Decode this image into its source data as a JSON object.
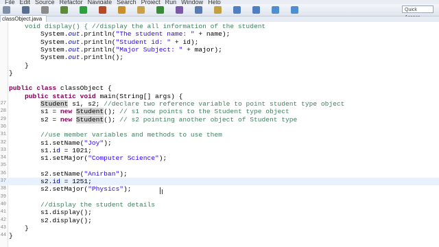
{
  "menu": [
    "File",
    "Edit",
    "Source",
    "Refactor",
    "Navigate",
    "Search",
    "Project",
    "Run",
    "Window",
    "Help"
  ],
  "quick_access": "Quick Access",
  "tab": {
    "label": "classObject.java"
  },
  "editor": {
    "lines": [
      {
        "n": "",
        "tokens": [
          {
            "t": "    void display() { //display the all information of the student",
            "c": "cm"
          }
        ]
      },
      {
        "n": "",
        "tokens": [
          {
            "t": "        System."
          },
          {
            "t": "out",
            "c": "st"
          },
          {
            "t": ".println("
          },
          {
            "t": "\"The student name: \"",
            "c": "str"
          },
          {
            "t": " + name);"
          }
        ]
      },
      {
        "n": "",
        "tokens": [
          {
            "t": "        System."
          },
          {
            "t": "out",
            "c": "st"
          },
          {
            "t": ".println("
          },
          {
            "t": "\"Student id: \"",
            "c": "str"
          },
          {
            "t": " + id);"
          }
        ]
      },
      {
        "n": "",
        "tokens": [
          {
            "t": "        System."
          },
          {
            "t": "out",
            "c": "st"
          },
          {
            "t": ".println("
          },
          {
            "t": "\"Major Subject: \"",
            "c": "str"
          },
          {
            "t": " + major);"
          }
        ]
      },
      {
        "n": "",
        "tokens": [
          {
            "t": "        System."
          },
          {
            "t": "out",
            "c": "st"
          },
          {
            "t": ".println();"
          }
        ]
      },
      {
        "n": "",
        "tokens": [
          {
            "t": "    }"
          }
        ]
      },
      {
        "n": "",
        "tokens": [
          {
            "t": "}"
          }
        ]
      },
      {
        "n": "",
        "tokens": [
          {
            "t": ""
          }
        ]
      },
      {
        "n": "",
        "tokens": [
          {
            "t": "public",
            "c": "kw"
          },
          {
            "t": " "
          },
          {
            "t": "class",
            "c": "kw"
          },
          {
            "t": " classObject {"
          }
        ]
      },
      {
        "n": "",
        "tokens": [
          {
            "t": "    "
          },
          {
            "t": "public",
            "c": "kw"
          },
          {
            "t": " "
          },
          {
            "t": "static",
            "c": "kw"
          },
          {
            "t": " "
          },
          {
            "t": "void",
            "c": "kw"
          },
          {
            "t": " main(String[] args) {"
          }
        ]
      },
      {
        "n": "27",
        "tokens": [
          {
            "t": "        "
          },
          {
            "t": "Student",
            "c": "hl"
          },
          {
            "t": " s1, s2; "
          },
          {
            "t": "//declare two reference variable to point student type object",
            "c": "cm"
          }
        ]
      },
      {
        "n": "28",
        "tokens": [
          {
            "t": "        s1 = "
          },
          {
            "t": "new",
            "c": "kw"
          },
          {
            "t": " "
          },
          {
            "t": "Student",
            "c": "hl"
          },
          {
            "t": "(); "
          },
          {
            "t": "// s1 now points to the Student type object",
            "c": "cm"
          }
        ]
      },
      {
        "n": "29",
        "tokens": [
          {
            "t": "        s2 = "
          },
          {
            "t": "new",
            "c": "kw"
          },
          {
            "t": " "
          },
          {
            "t": "Student",
            "c": "hl"
          },
          {
            "t": "(); "
          },
          {
            "t": "// s2 pointing another object of Student type",
            "c": "cm"
          }
        ]
      },
      {
        "n": "30",
        "tokens": [
          {
            "t": ""
          }
        ]
      },
      {
        "n": "31",
        "tokens": [
          {
            "t": "        "
          },
          {
            "t": "//use member variables and methods to use them",
            "c": "cm"
          }
        ]
      },
      {
        "n": "32",
        "tokens": [
          {
            "t": "        s1.setName("
          },
          {
            "t": "\"Joy\"",
            "c": "str"
          },
          {
            "t": ");"
          }
        ]
      },
      {
        "n": "33",
        "tokens": [
          {
            "t": "        s1."
          },
          {
            "t": "id",
            "c": "fld"
          },
          {
            "t": " = 1021;"
          }
        ]
      },
      {
        "n": "34",
        "tokens": [
          {
            "t": "        s1.setMajor("
          },
          {
            "t": "\"Computer Science\"",
            "c": "str"
          },
          {
            "t": ");"
          }
        ]
      },
      {
        "n": "35",
        "tokens": [
          {
            "t": ""
          }
        ]
      },
      {
        "n": "36",
        "tokens": [
          {
            "t": "        s2.setName("
          },
          {
            "t": "\"Anirban\"",
            "c": "str"
          },
          {
            "t": ");"
          }
        ]
      },
      {
        "n": "37",
        "current": true,
        "tokens": [
          {
            "t": "        s2."
          },
          {
            "t": "id",
            "c": "fld"
          },
          {
            "t": " = 1251;"
          }
        ]
      },
      {
        "n": "38",
        "tokens": [
          {
            "t": "        s2.setMajor("
          },
          {
            "t": "\"Physics\"",
            "c": "str"
          },
          {
            "t": ");"
          }
        ]
      },
      {
        "n": "39",
        "tokens": [
          {
            "t": ""
          }
        ]
      },
      {
        "n": "40",
        "tokens": [
          {
            "t": "        "
          },
          {
            "t": "//display the student details",
            "c": "cm"
          }
        ]
      },
      {
        "n": "41",
        "tokens": [
          {
            "t": "        s1.display();"
          }
        ]
      },
      {
        "n": "42",
        "tokens": [
          {
            "t": "        s2.display();"
          }
        ]
      },
      {
        "n": "43",
        "tokens": [
          {
            "t": "    }"
          }
        ]
      },
      {
        "n": "44",
        "tokens": [
          {
            "t": "}"
          }
        ]
      }
    ]
  },
  "toolbar_icons": [
    {
      "name": "new-icon",
      "color": "#7f8fa6"
    },
    {
      "name": "save-icon",
      "color": "#5a6f8f"
    },
    {
      "name": "print-icon",
      "color": "#8a8a8a"
    },
    {
      "name": "debug-icon",
      "color": "#5c8a3a"
    },
    {
      "name": "run-icon",
      "color": "#2e9e3e"
    },
    {
      "name": "external-tools-icon",
      "color": "#b34a2a"
    },
    {
      "name": "new-java-project-icon",
      "color": "#c8902a"
    },
    {
      "name": "new-package-icon",
      "color": "#c8a24a"
    },
    {
      "name": "new-class-icon",
      "color": "#3a8a3a"
    },
    {
      "name": "open-type-icon",
      "color": "#7a5aa8"
    },
    {
      "name": "search-icon",
      "color": "#5a7ab0"
    },
    {
      "name": "annotation-icon",
      "color": "#c0a040"
    },
    {
      "name": "next-annotation-icon",
      "color": "#4f7fc0"
    },
    {
      "name": "prev-annotation-icon",
      "color": "#4f7fc0"
    },
    {
      "name": "back-icon",
      "color": "#4f8fd0"
    },
    {
      "name": "forward-icon",
      "color": "#4f8fd0"
    }
  ]
}
